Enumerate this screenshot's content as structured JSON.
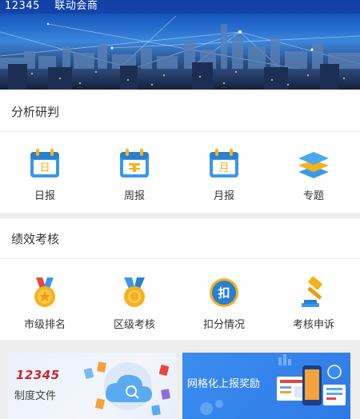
{
  "header": {
    "title": "12345    联动会商"
  },
  "analysis": {
    "title": "分析研判",
    "items": [
      {
        "label": "日报",
        "icon": "daily-calendar-icon",
        "glyph": "日"
      },
      {
        "label": "周报",
        "icon": "weekly-calendar-icon",
        "glyph": ""
      },
      {
        "label": "月报",
        "icon": "monthly-calendar-icon",
        "glyph": "月"
      },
      {
        "label": "专题",
        "icon": "layers-icon"
      }
    ]
  },
  "assessment": {
    "title": "绩效考核",
    "items": [
      {
        "label": "市级排名",
        "icon": "medal-icon"
      },
      {
        "label": "区级考核",
        "icon": "medal-ribbon-icon"
      },
      {
        "label": "扣分情况",
        "icon": "deduction-badge-icon",
        "glyph": "扣"
      },
      {
        "label": "考核申诉",
        "icon": "gavel-icon"
      }
    ]
  },
  "banners": {
    "left": {
      "big": "12345",
      "small": "制度文件"
    },
    "right": {
      "text": "网格化上报奖励"
    }
  },
  "colors": {
    "accent_blue": "#3a8df0",
    "gold": "#f5b21b",
    "red_text": "#c9282d"
  }
}
